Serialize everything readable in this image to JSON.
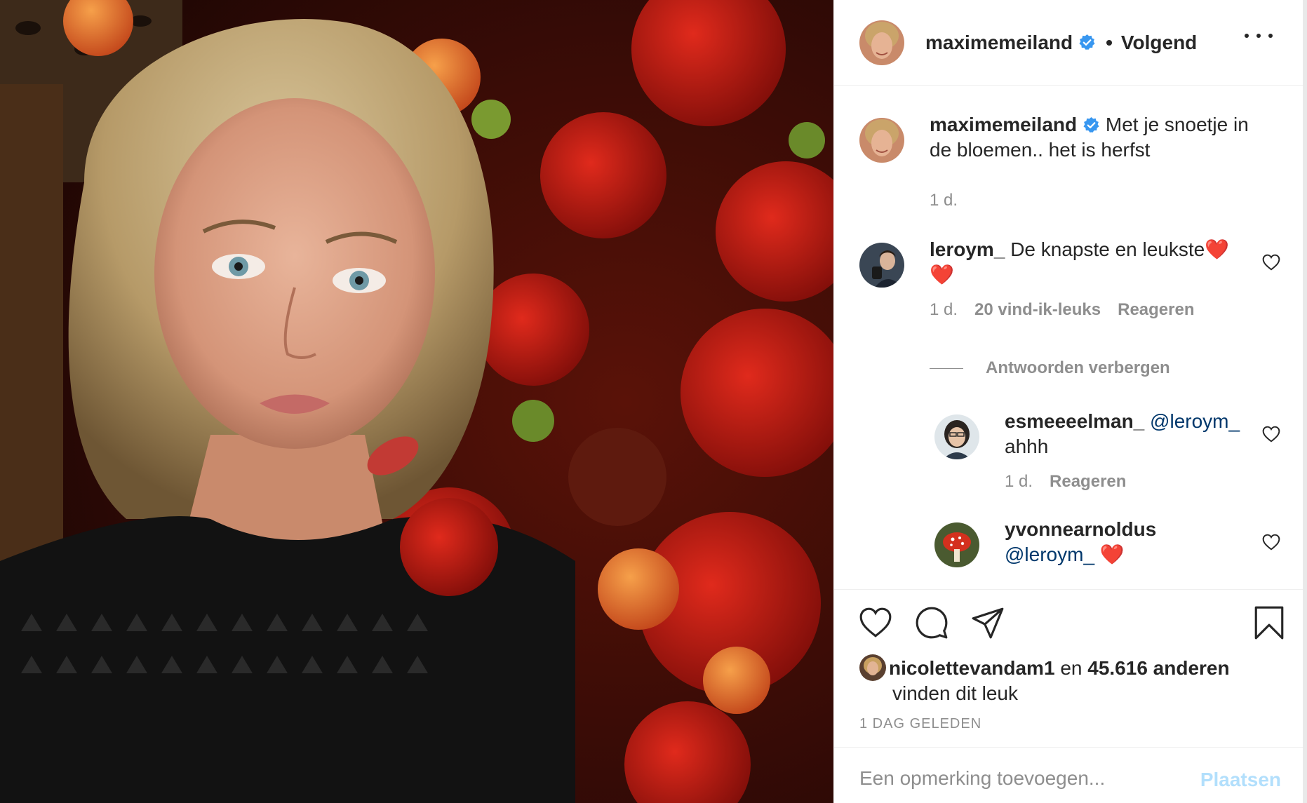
{
  "colors": {
    "verified": "#3897f0",
    "mention": "#00376b",
    "secondary_text": "#8e8e8e",
    "post_button_disabled": "#b2dffc",
    "like_heart": "#ed4956"
  },
  "header": {
    "username": "maximemeiland",
    "separator": "•",
    "follow_status": "Volgend",
    "more_icon": "more-horizontal-icon"
  },
  "caption": {
    "username": "maximemeiland",
    "text": "Met je snoetje in de bloemen.. het is herfst",
    "time": "1 d."
  },
  "comments": [
    {
      "username": "leroym_",
      "text": "De knapste en leukste",
      "emoji_line1": "❤️",
      "emoji_line2": "❤️",
      "time": "1 d.",
      "likes": "20 vind-ik-leuks",
      "reply_label": "Reageren",
      "hide_replies_label": "Antwoorden verbergen",
      "replies": [
        {
          "username": "esmeeeelman_",
          "mention": "@leroym_",
          "text": "ahhh",
          "time": "1 d.",
          "reply_label": "Reageren"
        },
        {
          "username": "yvonnearnoldus",
          "mention": "@leroym_",
          "emoji": "❤️"
        }
      ]
    }
  ],
  "actions": {
    "like_icon": "heart-icon",
    "comment_icon": "comment-icon",
    "share_icon": "paper-plane-icon",
    "save_icon": "bookmark-icon"
  },
  "likes": {
    "first_user": "nicolettevandam1",
    "connector": "en",
    "others": "45.616 anderen",
    "suffix": "vinden dit leuk"
  },
  "posted": "1 DAG GELEDEN",
  "add_comment": {
    "placeholder": "Een opmerking toevoegen...",
    "post_label": "Plaatsen"
  }
}
